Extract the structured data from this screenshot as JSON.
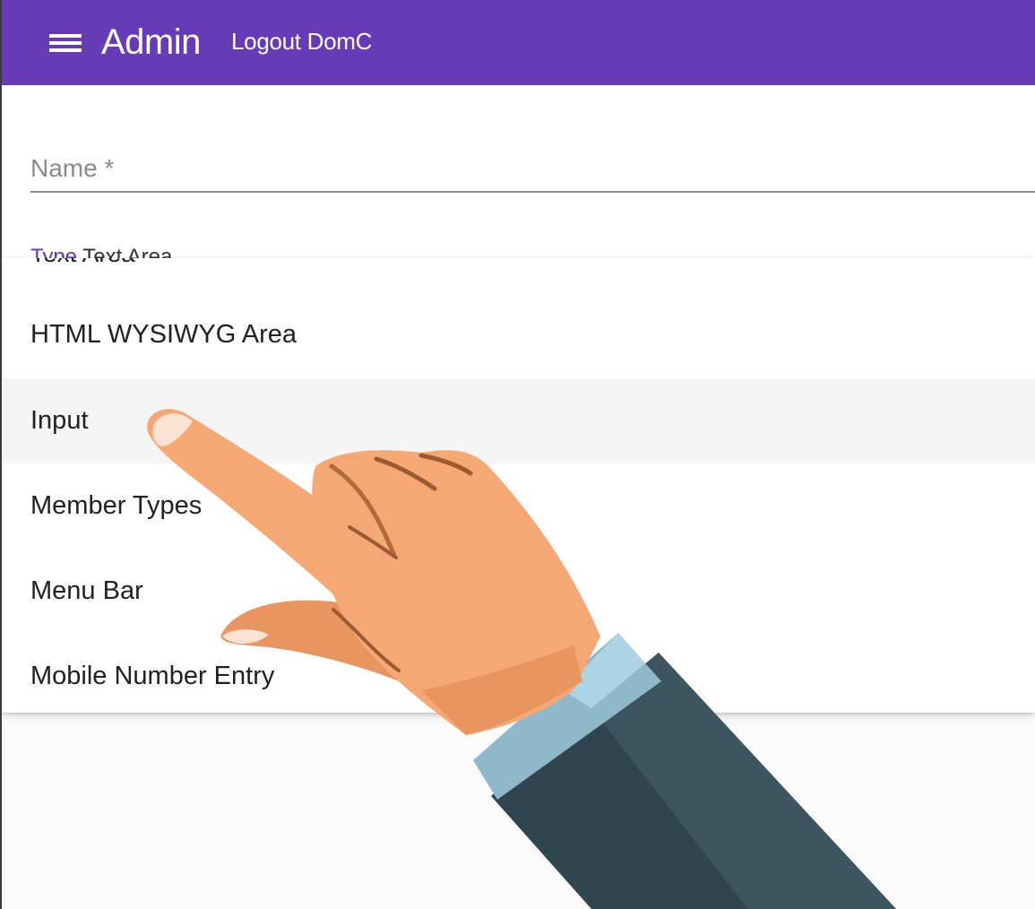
{
  "header": {
    "menu_icon": "menu-icon",
    "title": "Admin",
    "logout_label": "Logout DomC",
    "background_color": "#673ab7"
  },
  "form": {
    "name_field": {
      "placeholder": "Name *",
      "value": ""
    },
    "type_field": {
      "label": "Type",
      "partial_value": "Text Area"
    }
  },
  "dropdown": {
    "partial_option": "Text Area",
    "options": [
      {
        "label": "HTML WYSIWYG Area",
        "highlighted": false
      },
      {
        "label": "Input",
        "highlighted": true
      },
      {
        "label": "Member Types",
        "highlighted": false
      },
      {
        "label": "Menu Bar",
        "highlighted": false
      },
      {
        "label": "Mobile Number Entry",
        "highlighted": false
      }
    ]
  },
  "overlay": {
    "icon": "pointing-hand-icon"
  }
}
